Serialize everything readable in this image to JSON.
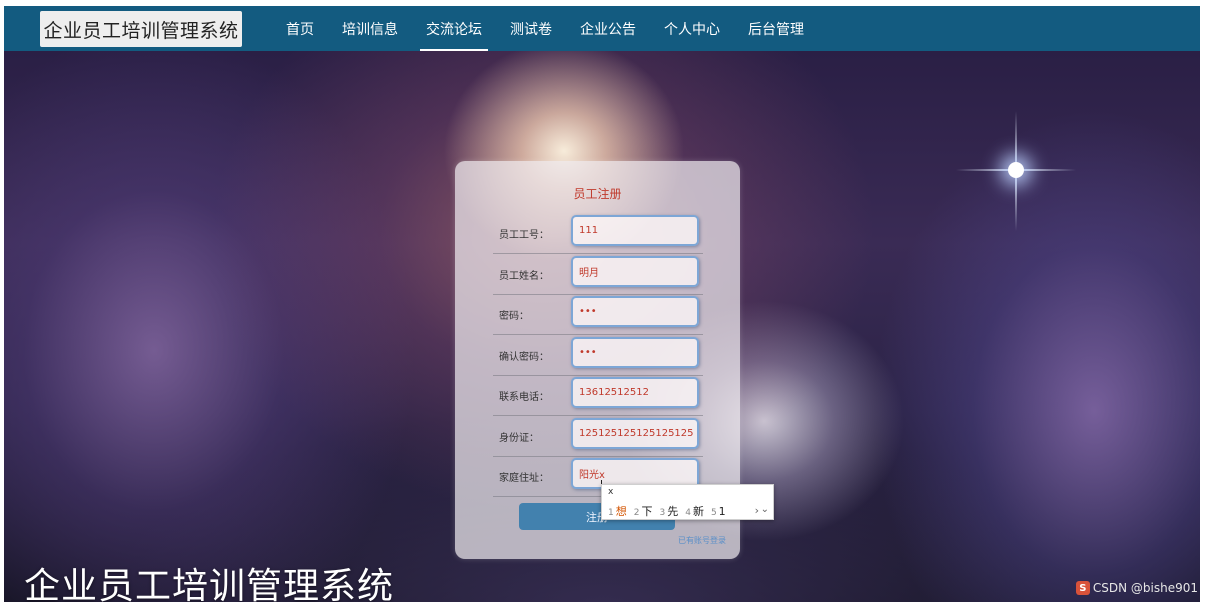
{
  "header": {
    "logo_text": "企业员工培训管理系统",
    "nav": [
      {
        "label": "首页"
      },
      {
        "label": "培训信息"
      },
      {
        "label": "交流论坛"
      },
      {
        "label": "测试卷"
      },
      {
        "label": "企业公告"
      },
      {
        "label": "个人中心"
      },
      {
        "label": "后台管理"
      }
    ],
    "active_index": 2
  },
  "form": {
    "title": "员工注册",
    "fields": [
      {
        "label": "员工工号：",
        "value": "111"
      },
      {
        "label": "员工姓名：",
        "value": "明月"
      },
      {
        "label": "密码：",
        "value": "•••"
      },
      {
        "label": "确认密码：",
        "value": "•••"
      },
      {
        "label": "联系电话：",
        "value": "13612512512"
      },
      {
        "label": "身份证：",
        "value": "125125125125125125"
      },
      {
        "label": "家庭住址：",
        "value": "阳光x"
      }
    ],
    "submit_label": "注册",
    "link_text": "已有账号登录"
  },
  "ime": {
    "composition": "x",
    "candidates": [
      {
        "num": "1",
        "text": "想"
      },
      {
        "num": "2",
        "text": "下"
      },
      {
        "num": "3",
        "text": "先"
      },
      {
        "num": "4",
        "text": "新"
      },
      {
        "num": "5",
        "text": "1"
      }
    ],
    "next_symbol": "›",
    "expand_symbol": "⌄"
  },
  "footer_title": "企业员工培训管理系统",
  "watermark": {
    "logo": "S",
    "text": "CSDN @bishe901"
  },
  "colors": {
    "navbar": "#135b80",
    "accent_red": "#c0392b",
    "button": "#2d78aa"
  }
}
